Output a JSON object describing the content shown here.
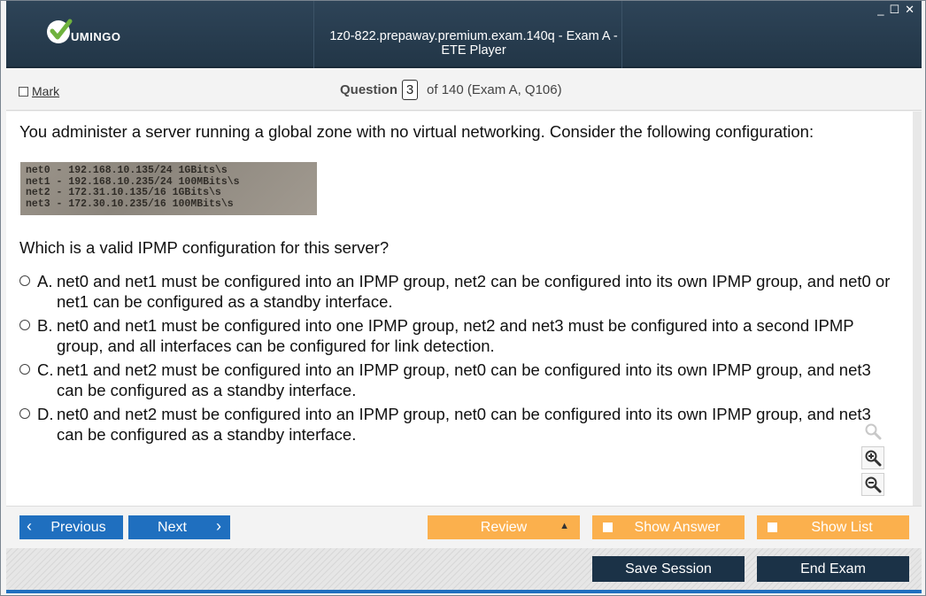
{
  "titlebar": {
    "logo_text": "UMINGO",
    "title": "1z0-822.prepaway.premium.exam.140q - Exam A - ETE Player",
    "controls": [
      "_",
      "☐",
      "✕"
    ]
  },
  "header": {
    "mark_label": "Mark",
    "question_label": "Question",
    "question_number": "3",
    "question_total": "of 140 (Exam A, Q106)"
  },
  "content": {
    "question_text": "You administer a server running a global zone with no virtual networking. Consider the following configuration:",
    "exhibit_lines": [
      "net0 - 192.168.10.135/24 1GBits\\s",
      "net1 - 192.168.10.235/24 100MBits\\s",
      "net2 - 172.31.10.135/16 1GBits\\s",
      "net3 - 172.30.10.235/16 100MBits\\s"
    ],
    "prompt": "Which is a valid IPMP configuration for this server?",
    "answers": [
      {
        "letter": "A.",
        "text": "net0 and net1 must be configured into an IPMP group, net2 can be configured into its own IPMP group, and net0 or net1 can be configured as a standby interface."
      },
      {
        "letter": "B.",
        "text": "net0 and net1 must be configured into one IPMP group, net2 and net3 must be configured into a second IPMP group, and all interfaces can be configured for link detection."
      },
      {
        "letter": "C.",
        "text": "net1 and net2 must be configured into an IPMP group, net0 can be configured into its own IPMP group, and net3 can be configured as a standby interface."
      },
      {
        "letter": "D.",
        "text": "net0 and net2 must be configured into an IPMP group, net0 can be configured into its own IPMP group, and net3 can be configured as a standby interface."
      }
    ]
  },
  "nav": {
    "previous_label": "Previous",
    "next_label": "Next",
    "review_label": "Review",
    "show_answer_label": "Show Answer",
    "show_list_label": "Show List",
    "save_session_label": "Save Session",
    "end_exam_label": "End Exam"
  },
  "colors": {
    "titlebar": "#2a3f52",
    "blue_button": "#1f6fbf",
    "orange_button": "#fbb04d",
    "dark_button": "#1b3247"
  }
}
